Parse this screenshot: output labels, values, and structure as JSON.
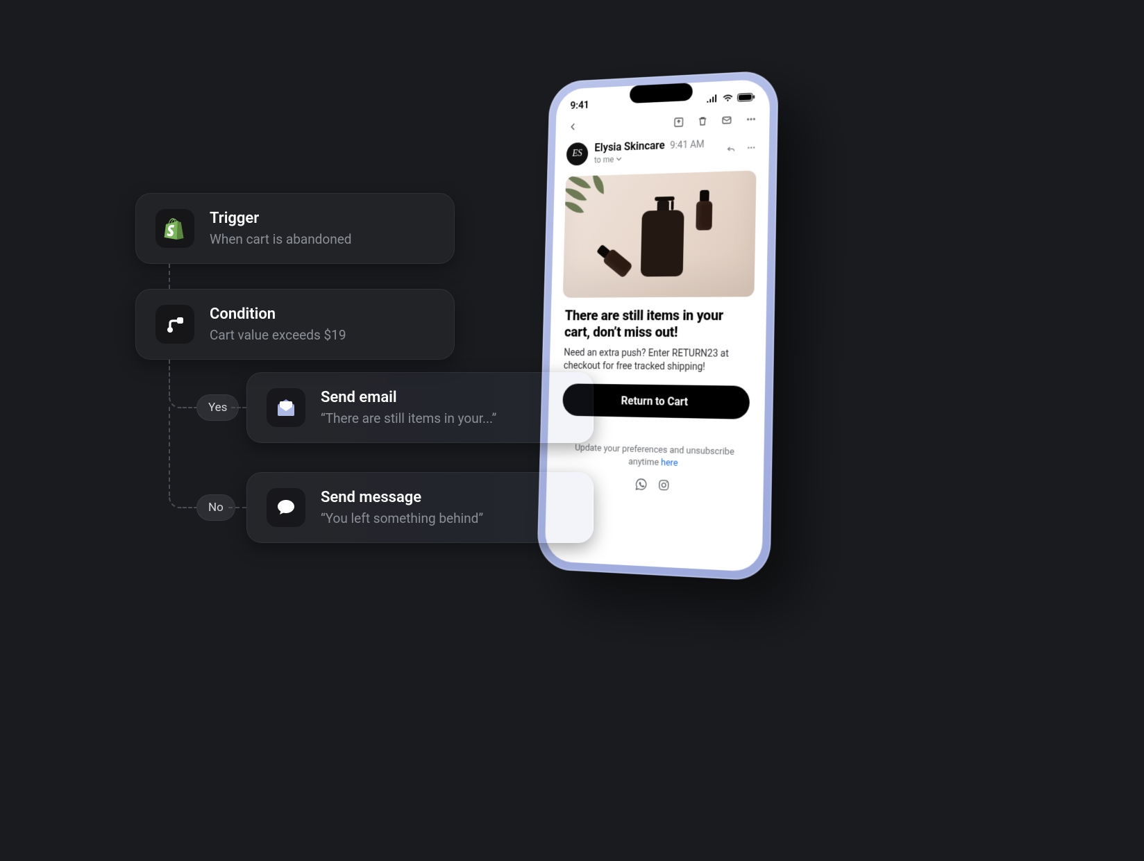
{
  "workflow": {
    "trigger": {
      "title": "Trigger",
      "sub": "When cart is abandoned"
    },
    "condition": {
      "title": "Condition",
      "sub": "Cart value exceeds $19"
    },
    "branches": {
      "yes": "Yes",
      "no": "No"
    },
    "send_email": {
      "title": "Send email",
      "sub": "“There are still items in your...”"
    },
    "send_msg": {
      "title": "Send message",
      "sub": "“You left something behind”"
    }
  },
  "phone": {
    "time": "9:41",
    "sender": {
      "name": "Elysia Skincare",
      "time": "9:41 AM",
      "to": "to me",
      "avatar": "ES"
    },
    "email": {
      "headline": "There are still items in your cart, don’t miss out!",
      "body": "Need an extra push? Enter RETURN23 at checkout for free tracked shipping!",
      "cta": "Return to Cart",
      "footer_1": "Update your preferences and unsubscribe anytime ",
      "footer_link": "here"
    }
  }
}
